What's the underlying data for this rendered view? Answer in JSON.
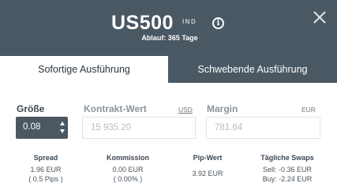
{
  "header": {
    "title": "US500",
    "badge": "IND",
    "expiry": "Ablauf: 365 Tage"
  },
  "tabs": {
    "instant": "Sofortige Ausführung",
    "pending": "Schwebende Ausführung"
  },
  "size": {
    "label": "Größe",
    "value": "0.08"
  },
  "contract": {
    "label": "Kontrakt-Wert",
    "currency": "USD",
    "value": "15 935.20"
  },
  "margin": {
    "label": "Margin",
    "currency": "EUR",
    "value": "781.64"
  },
  "stats": {
    "spread": {
      "title": "Spread",
      "line1": "1.96 EUR",
      "line2": "( 0.5 Pips )"
    },
    "commission": {
      "title": "Kommission",
      "line1": "0.00 EUR",
      "line2": "( 0.00% )"
    },
    "pip": {
      "title": "Pip-Wert",
      "line1": "3.92 EUR"
    },
    "swaps": {
      "title": "Tägliche Swaps",
      "line1": "Sell: -0.36 EUR",
      "line2": "Buy: -2.24 EUR"
    }
  },
  "icons": {
    "info": "info-icon",
    "close": "close-icon",
    "increment": "chevron-up-icon",
    "decrement": "chevron-down-icon"
  },
  "colors": {
    "header_bg": "#4a5863",
    "text": "#3c4a55"
  }
}
